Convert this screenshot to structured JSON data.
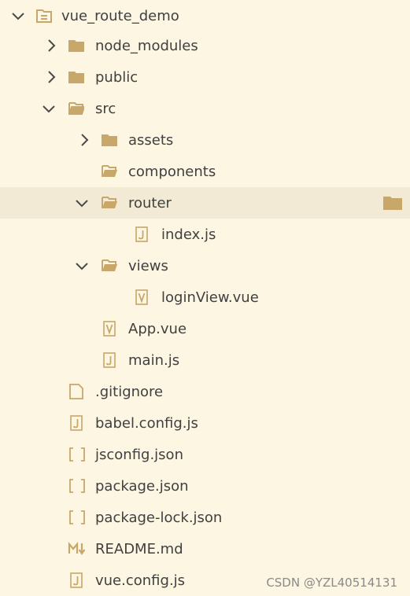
{
  "explorer": {
    "rows": [
      {
        "label": "vue_route_demo",
        "icon": "root-folder-icon",
        "chevron": "down",
        "level": 0
      },
      {
        "label": "node_modules",
        "icon": "folder-closed-icon",
        "chevron": "right",
        "level": 1
      },
      {
        "label": "public",
        "icon": "folder-closed-icon",
        "chevron": "right",
        "level": 1
      },
      {
        "label": "src",
        "icon": "folder-open-icon",
        "chevron": "down",
        "level": 1
      },
      {
        "label": "assets",
        "icon": "folder-closed-icon",
        "chevron": "right",
        "level": 2
      },
      {
        "label": "components",
        "icon": "folder-open-icon",
        "chevron": "none",
        "level": 2
      },
      {
        "label": "router",
        "icon": "folder-open-icon",
        "chevron": "down",
        "level": 2,
        "selected": true
      },
      {
        "label": "index.js",
        "icon": "js-file-icon",
        "chevron": "none",
        "level": 3
      },
      {
        "label": "views",
        "icon": "folder-open-icon",
        "chevron": "down",
        "level": 2
      },
      {
        "label": "loginView.vue",
        "icon": "vue-file-icon",
        "chevron": "none",
        "level": 3
      },
      {
        "label": "App.vue",
        "icon": "vue-file-icon",
        "chevron": "none",
        "level": 2
      },
      {
        "label": "main.js",
        "icon": "js-file-icon",
        "chevron": "none",
        "level": 2
      },
      {
        "label": ".gitignore",
        "icon": "blank-file-icon",
        "chevron": "none",
        "level": 1
      },
      {
        "label": "babel.config.js",
        "icon": "js-file-icon",
        "chevron": "none",
        "level": 1
      },
      {
        "label": "jsconfig.json",
        "icon": "json-file-icon",
        "chevron": "none",
        "level": 1
      },
      {
        "label": "package.json",
        "icon": "json-file-icon",
        "chevron": "none",
        "level": 1
      },
      {
        "label": "package-lock.json",
        "icon": "json-file-icon",
        "chevron": "none",
        "level": 1
      },
      {
        "label": "README.md",
        "icon": "markdown-file-icon",
        "chevron": "none",
        "level": 1
      },
      {
        "label": "vue.config.js",
        "icon": "js-file-icon",
        "chevron": "none",
        "level": 1
      }
    ],
    "selected_trailing_icon": "folder-closed-icon"
  },
  "watermark": "CSDN @YZL40514131",
  "colors": {
    "background": "#fdf6e3",
    "selected_row": "#f2ead4",
    "folder": "#c7a76a",
    "chevron": "#4a4a4a"
  }
}
